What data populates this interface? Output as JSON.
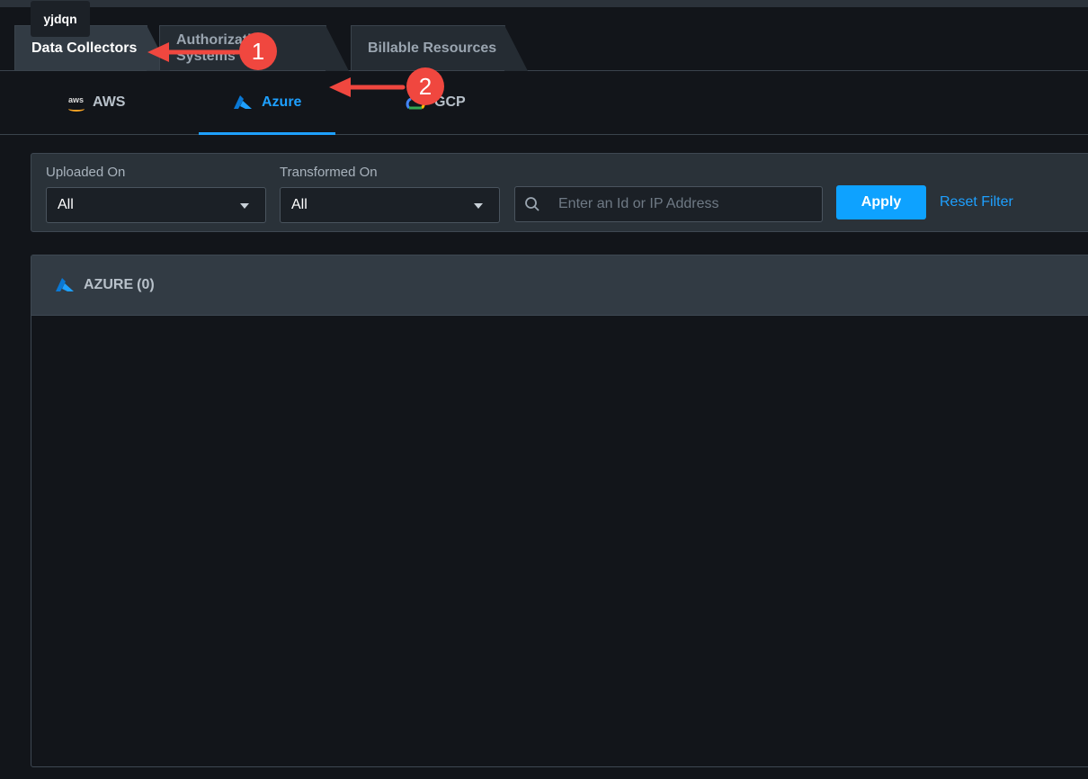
{
  "tooltip": "yjdqn",
  "tabs": [
    {
      "label": "Data Collectors"
    },
    {
      "label": "Authorization Systems"
    },
    {
      "label": "Billable Resources"
    }
  ],
  "providers": [
    {
      "label": "AWS",
      "logo_text": "aws"
    },
    {
      "label": "Azure"
    },
    {
      "label": "GCP"
    }
  ],
  "filters": {
    "uploaded_label": "Uploaded On",
    "uploaded_value": "All",
    "transformed_label": "Transformed On",
    "transformed_value": "All",
    "search_placeholder": "Enter an Id or IP Address",
    "search_value": "",
    "apply_label": "Apply",
    "reset_label": "Reset Filter"
  },
  "panel": {
    "title": "AZURE",
    "count": "(0)"
  },
  "annotations": [
    {
      "number": "1"
    },
    {
      "number": "2"
    }
  ],
  "colors": {
    "accent": "#1ea0ff",
    "apply_button": "#0ea2ff",
    "annotation": "#f0473f",
    "background": "#12151a"
  }
}
